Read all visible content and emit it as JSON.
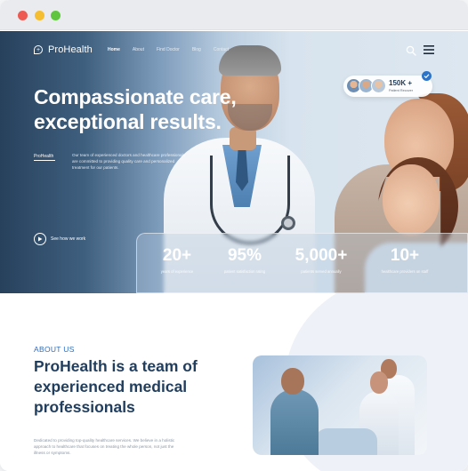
{
  "site": {
    "brand": "ProHealth"
  },
  "nav": {
    "items": [
      "Home",
      "About",
      "Find Doctor",
      "Blog",
      "Contact"
    ],
    "active": "Home"
  },
  "hero": {
    "title": "Compassionate care, exceptional results.",
    "tag": "ProHealth",
    "description": "Our team of experienced doctors and healthcare professionals are committed to providing quality care and personalized treatment for our patients.",
    "play_label": "See how we work",
    "badge": {
      "count": "150K +",
      "label": "Patient Recover"
    },
    "stats": [
      {
        "value": "20+",
        "label": "years of experience"
      },
      {
        "value": "95%",
        "label": "patient satisfaction rating"
      },
      {
        "value": "5,000+",
        "label": "patients served annually"
      },
      {
        "value": "10+",
        "label": "healthcare providers on staff"
      }
    ]
  },
  "about": {
    "eyebrow": "ABOUT US",
    "title": "ProHealth is a team of experienced medical professionals",
    "description": "Dedicated to providing top-quality healthcare services. We believe in a holistic approach to healthcare that focuses on treating the whole person, not just the illness or symptoms."
  },
  "icons": {
    "logo": "shield-plus-icon",
    "search": "search-icon",
    "menu": "hamburger-menu-icon",
    "play": "play-icon",
    "check": "check-badge-icon"
  },
  "colors": {
    "hero_dark": "#27415c",
    "accent_blue": "#2b6cc4",
    "title_navy": "#213e5e",
    "badge_check": "#2c74c9"
  }
}
